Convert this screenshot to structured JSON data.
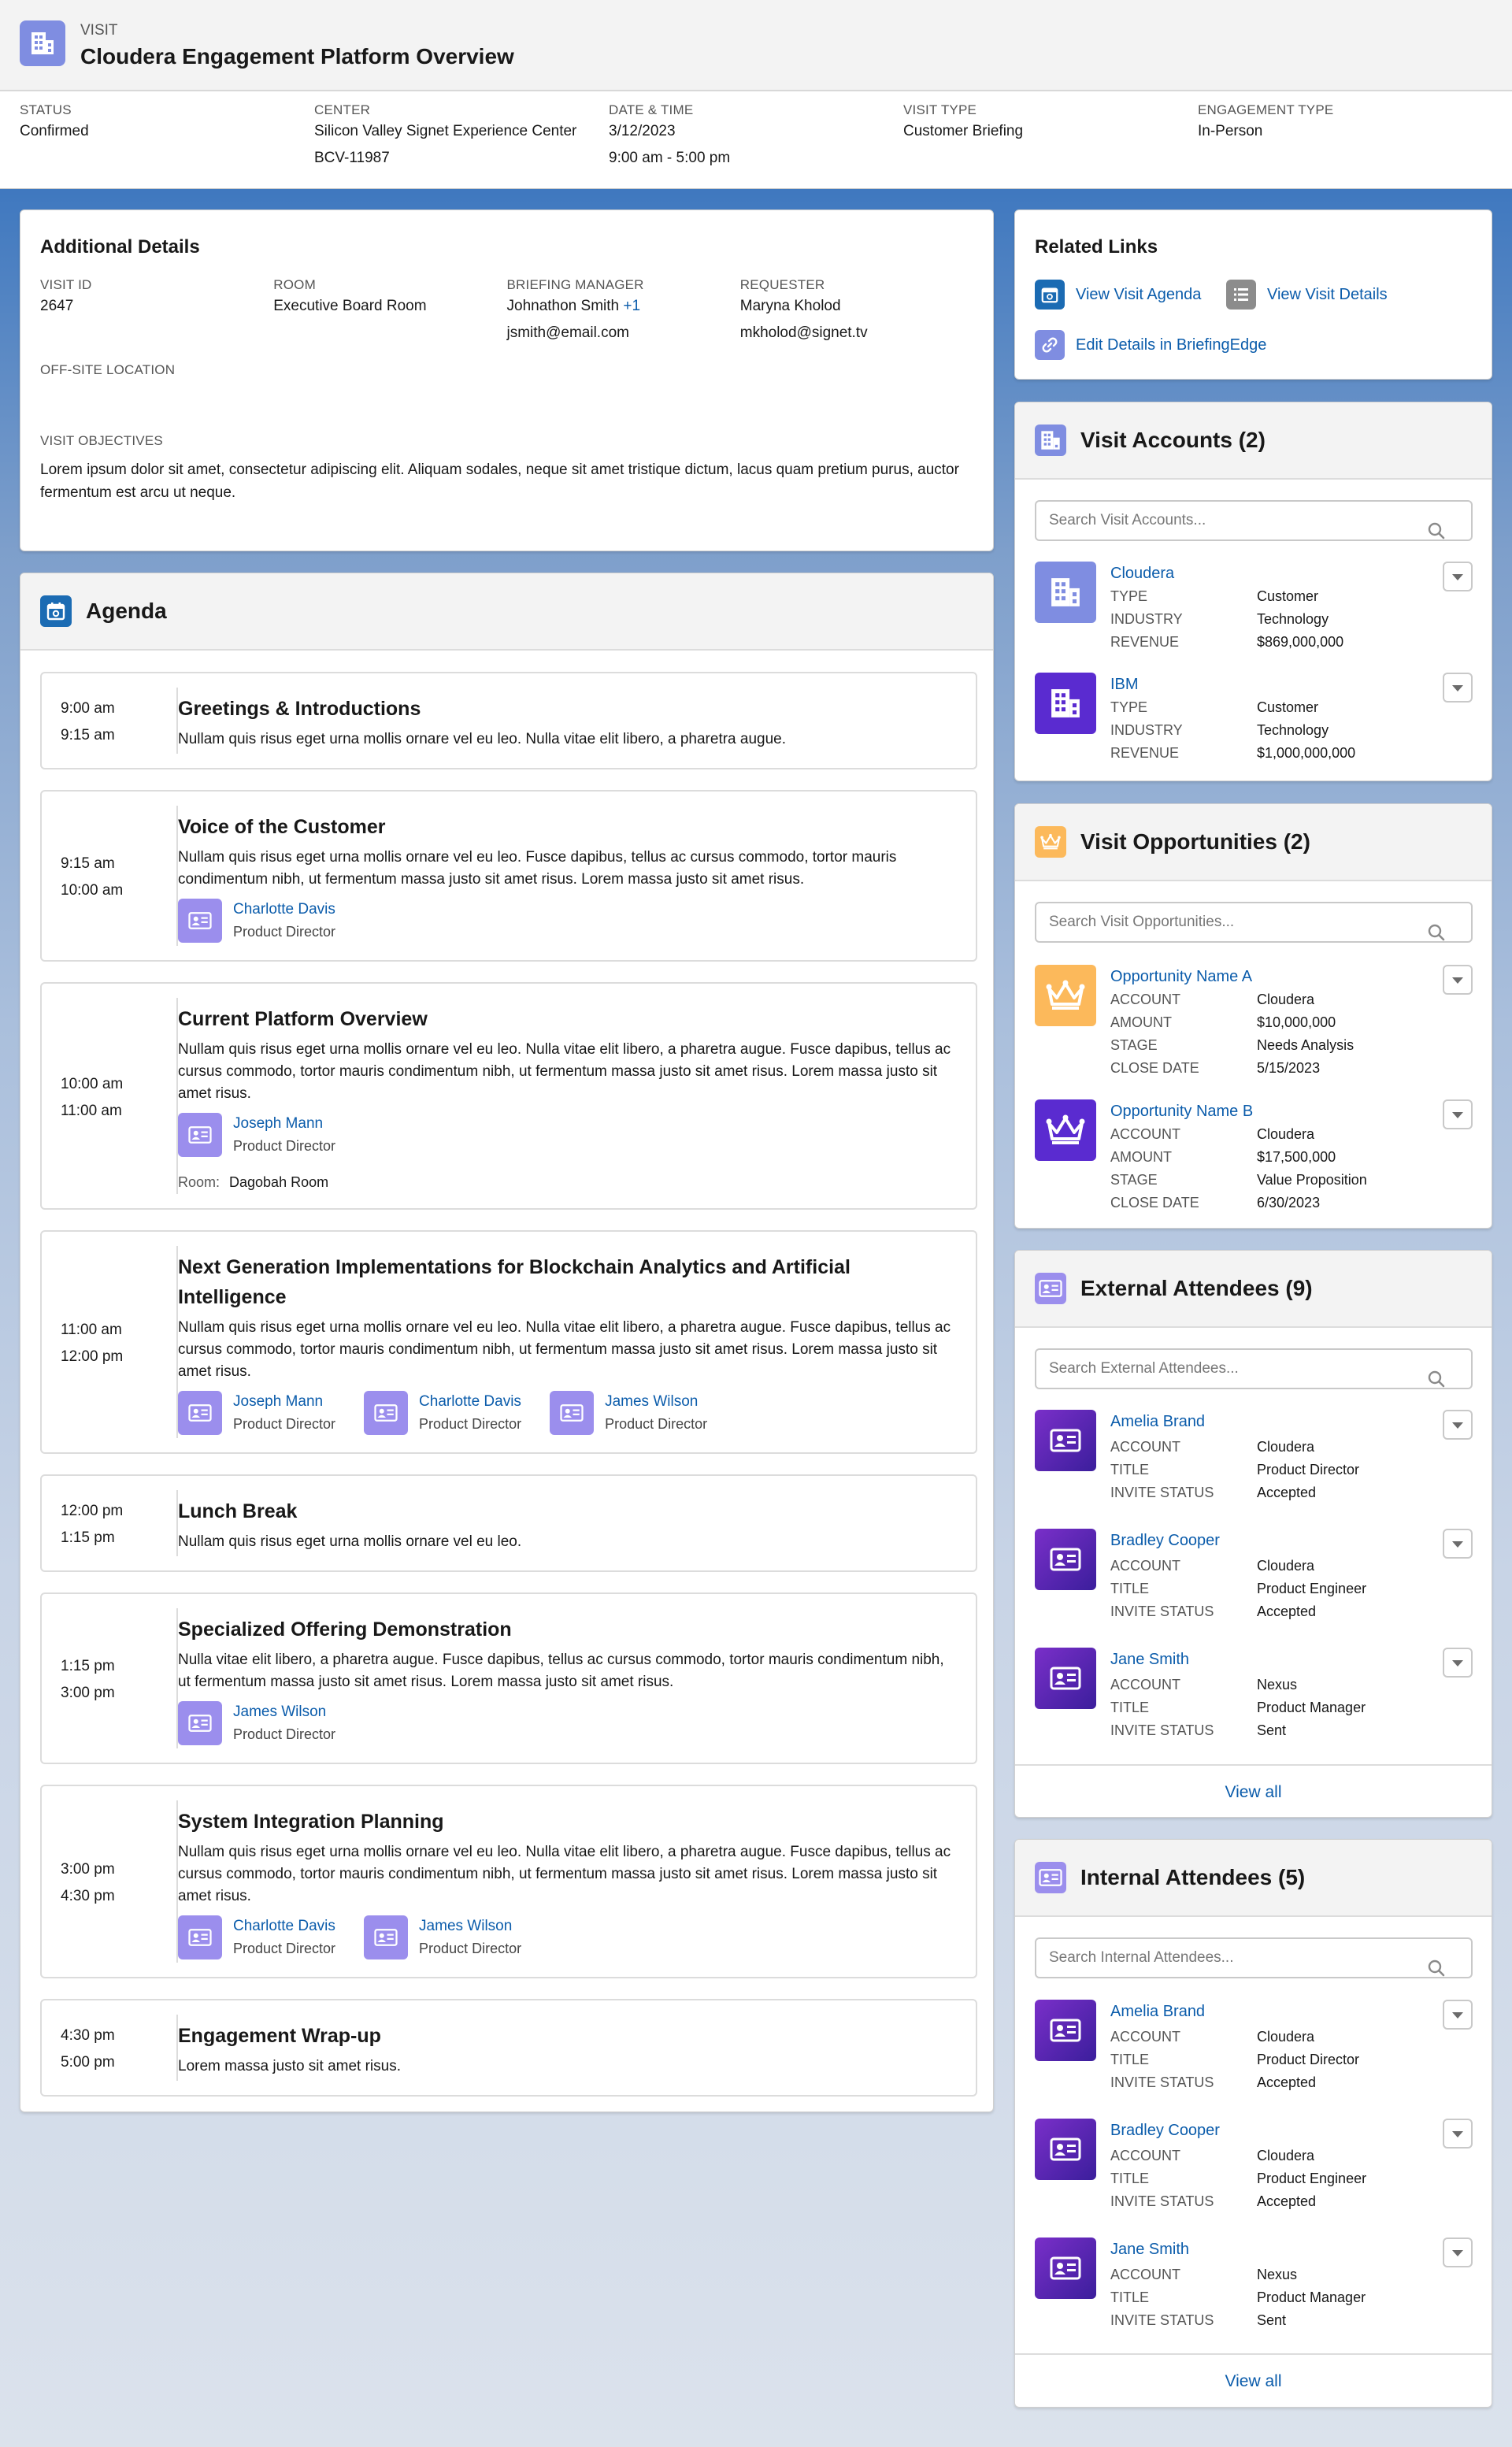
{
  "header": {
    "eyebrow": "VISIT",
    "title": "Cloudera Engagement Platform Overview",
    "fields": [
      {
        "label": "STATUS",
        "lines": [
          "Confirmed"
        ]
      },
      {
        "label": "CENTER",
        "lines": [
          "Silicon Valley Signet Experience Center",
          "BCV-11987"
        ]
      },
      {
        "label": "DATE & TIME",
        "lines": [
          "3/12/2023",
          "9:00 am - 5:00 pm"
        ]
      },
      {
        "label": "VISIT TYPE",
        "lines": [
          "Customer Briefing"
        ]
      },
      {
        "label": "ENGAGEMENT TYPE",
        "lines": [
          "In-Person"
        ]
      }
    ]
  },
  "details": {
    "title": "Additional Details",
    "visit_id_label": "VISIT ID",
    "visit_id": "2647",
    "room_label": "ROOM",
    "room": "Executive Board Room",
    "manager_label": "BRIEFING MANAGER",
    "manager": "Johnathon Smith",
    "manager_more": "+1",
    "manager_email": "jsmith@email.com",
    "requester_label": "REQUESTER",
    "requester": "Maryna Kholod",
    "requester_email": "mkholod@signet.tv",
    "offsite_label": "OFF-SITE LOCATION",
    "objectives_label": "VISIT OBJECTIVES",
    "objectives": "Lorem ipsum dolor sit amet, consectetur adipiscing elit. Aliquam sodales, neque sit amet tristique dictum, lacus quam pretium purus, auctor fermentum est arcu ut neque."
  },
  "agenda": {
    "title": "Agenda",
    "room_label": "Room:",
    "items": [
      {
        "start": "9:00 am",
        "end": "9:15 am",
        "title": "Greetings & Introductions",
        "desc": "Nullam quis risus eget urna mollis ornare vel eu leo. Nulla vitae elit libero, a pharetra augue.",
        "speakers": []
      },
      {
        "start": "9:15 am",
        "end": "10:00 am",
        "title": "Voice of the Customer",
        "desc": "Nullam quis risus eget urna mollis ornare vel eu leo. Fusce dapibus, tellus ac cursus commodo, tortor mauris condimentum nibh, ut fermentum massa justo sit amet risus. Lorem massa justo sit amet risus.",
        "speakers": [
          {
            "name": "Charlotte Davis",
            "role": "Product Director"
          }
        ]
      },
      {
        "start": "10:00 am",
        "end": "11:00 am",
        "title": "Current Platform Overview",
        "desc": "Nullam quis risus eget urna mollis ornare vel eu leo. Nulla vitae elit libero, a pharetra augue. Fusce dapibus, tellus ac cursus commodo, tortor mauris condimentum nibh, ut fermentum massa justo sit amet risus. Lorem massa justo sit amet risus.",
        "speakers": [
          {
            "name": "Joseph Mann",
            "role": "Product Director"
          }
        ],
        "room": "Dagobah Room"
      },
      {
        "start": "11:00 am",
        "end": "12:00 pm",
        "title": "Next Generation Implementations for Blockchain Analytics and Artificial Intelligence",
        "desc": "Nullam quis risus eget urna mollis ornare vel eu leo. Nulla vitae elit libero, a pharetra augue. Fusce dapibus, tellus ac cursus commodo, tortor mauris condimentum nibh, ut fermentum massa justo sit amet risus. Lorem massa justo sit amet risus.",
        "speakers": [
          {
            "name": "Joseph Mann",
            "role": "Product Director"
          },
          {
            "name": "Charlotte Davis",
            "role": "Product Director"
          },
          {
            "name": "James Wilson",
            "role": "Product Director"
          }
        ]
      },
      {
        "start": "12:00 pm",
        "end": "1:15 pm",
        "title": "Lunch Break",
        "desc": "Nullam quis risus eget urna mollis ornare vel eu leo.",
        "speakers": []
      },
      {
        "start": "1:15 pm",
        "end": "3:00 pm",
        "title": "Specialized Offering Demonstration",
        "desc": "Nulla vitae elit libero, a pharetra augue. Fusce dapibus, tellus ac cursus commodo, tortor mauris condimentum nibh, ut fermentum massa justo sit amet risus. Lorem massa justo sit amet risus.",
        "speakers": [
          {
            "name": "James Wilson",
            "role": "Product Director"
          }
        ]
      },
      {
        "start": "3:00 pm",
        "end": "4:30 pm",
        "title": "System Integration Planning",
        "desc": "Nullam quis risus eget urna mollis ornare vel eu leo. Nulla vitae elit libero, a pharetra augue. Fusce dapibus, tellus ac cursus commodo, tortor mauris condimentum nibh, ut fermentum massa justo sit amet risus. Lorem massa justo sit amet risus.",
        "speakers": [
          {
            "name": "Charlotte Davis",
            "role": "Product Director"
          },
          {
            "name": "James Wilson",
            "role": "Product Director"
          }
        ]
      },
      {
        "start": "4:30 pm",
        "end": "5:00 pm",
        "title": "Engagement Wrap-up",
        "desc": "Lorem massa justo sit amet risus.",
        "speakers": []
      }
    ]
  },
  "related": {
    "title": "Related Links",
    "links": [
      {
        "label": "View Visit Agenda",
        "icon": "calendar-icon"
      },
      {
        "label": "View Visit Details",
        "icon": "list-icon"
      },
      {
        "label": "Edit Details in BriefingEdge",
        "icon": "link-icon"
      }
    ]
  },
  "accounts": {
    "title": "Visit Accounts (2)",
    "placeholder": "Search Visit Accounts...",
    "items": [
      {
        "name": "Cloudera",
        "fields": [
          [
            "TYPE",
            "Customer"
          ],
          [
            "INDUSTRY",
            "Technology"
          ],
          [
            "REVENUE",
            "$869,000,000"
          ]
        ],
        "color": "#7f8de1"
      },
      {
        "name": "IBM",
        "fields": [
          [
            "TYPE",
            "Customer"
          ],
          [
            "INDUSTRY",
            "Technology"
          ],
          [
            "REVENUE",
            "$1,000,000,000"
          ]
        ],
        "color": "#5a2bd0"
      }
    ]
  },
  "opportunities": {
    "title": "Visit Opportunities (2)",
    "placeholder": "Search Visit Opportunities...",
    "items": [
      {
        "name": "Opportunity Name A",
        "fields": [
          [
            "ACCOUNT",
            "Cloudera"
          ],
          [
            "AMOUNT",
            "$10,000,000"
          ],
          [
            "STAGE",
            "Needs Analysis"
          ],
          [
            "CLOSE DATE",
            "5/15/2023"
          ]
        ],
        "color": "#fcb95b"
      },
      {
        "name": "Opportunity Name B",
        "fields": [
          [
            "ACCOUNT",
            "Cloudera"
          ],
          [
            "AMOUNT",
            "$17,500,000"
          ],
          [
            "STAGE",
            "Value Proposition"
          ],
          [
            "CLOSE DATE",
            "6/30/2023"
          ]
        ],
        "color": "#5a2bd0"
      }
    ]
  },
  "external": {
    "title": "External Attendees (9)",
    "placeholder": "Search External Attendees...",
    "view_all": "View all",
    "items": [
      {
        "name": "Amelia Brand",
        "fields": [
          [
            "ACCOUNT",
            "Cloudera"
          ],
          [
            "TITLE",
            "Product Director"
          ],
          [
            "INVITE STATUS",
            "Accepted"
          ]
        ]
      },
      {
        "name": "Bradley Cooper",
        "fields": [
          [
            "ACCOUNT",
            "Cloudera"
          ],
          [
            "TITLE",
            "Product Engineer"
          ],
          [
            "INVITE STATUS",
            "Accepted"
          ]
        ]
      },
      {
        "name": "Jane Smith",
        "fields": [
          [
            "ACCOUNT",
            "Nexus"
          ],
          [
            "TITLE",
            "Product Manager"
          ],
          [
            "INVITE STATUS",
            "Sent"
          ]
        ]
      }
    ]
  },
  "internal": {
    "title": "Internal Attendees (5)",
    "placeholder": "Search Internal Attendees...",
    "view_all": "View all",
    "items": [
      {
        "name": "Amelia Brand",
        "fields": [
          [
            "ACCOUNT",
            "Cloudera"
          ],
          [
            "TITLE",
            "Product Director"
          ],
          [
            "INVITE STATUS",
            "Accepted"
          ]
        ]
      },
      {
        "name": "Bradley Cooper",
        "fields": [
          [
            "ACCOUNT",
            "Cloudera"
          ],
          [
            "TITLE",
            "Product Engineer"
          ],
          [
            "INVITE STATUS",
            "Accepted"
          ]
        ]
      },
      {
        "name": "Jane Smith",
        "fields": [
          [
            "ACCOUNT",
            "Nexus"
          ],
          [
            "TITLE",
            "Product Manager"
          ],
          [
            "INVITE STATUS",
            "Sent"
          ]
        ]
      }
    ]
  },
  "colors": {
    "accent_link": "#0b5cab",
    "contact_purple": "#5a2bd0",
    "speaker_lavender": "#9b8eed",
    "account_blue": "#7f8de1",
    "opportunity_orange": "#fcb95b"
  }
}
